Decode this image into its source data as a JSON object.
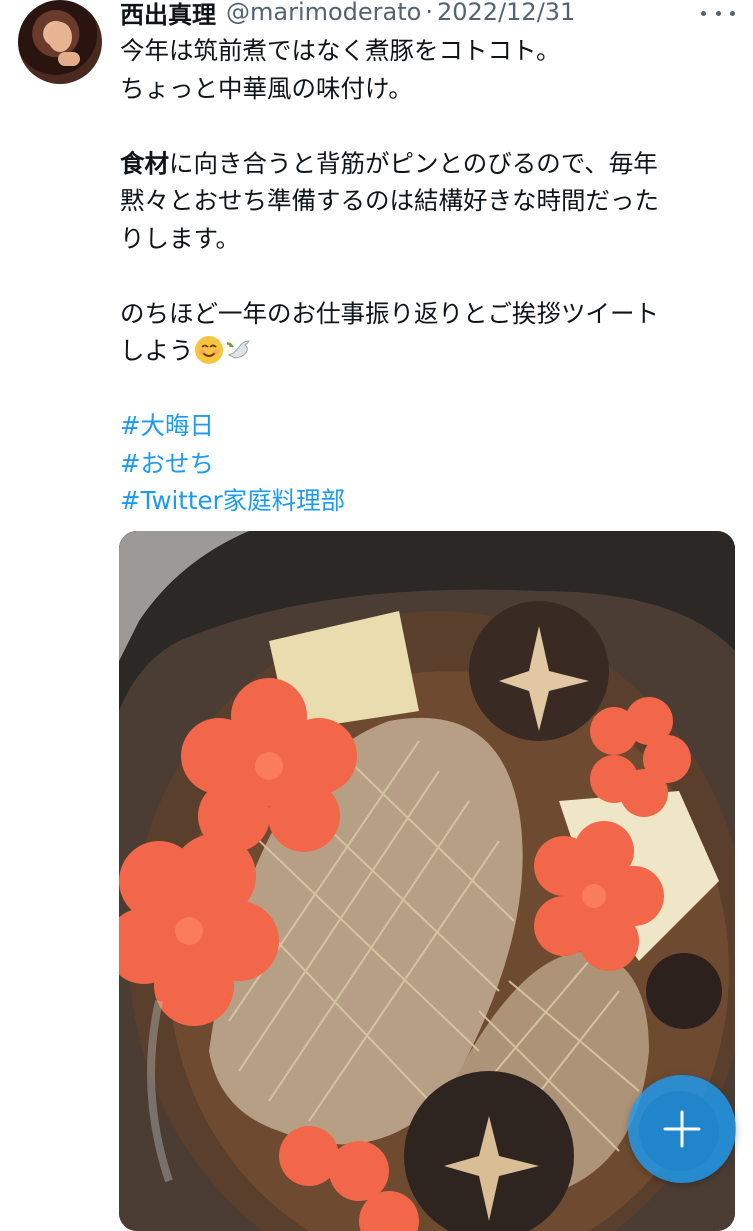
{
  "tweet": {
    "author": {
      "display_name": "西出真理",
      "handle": "@marimoderato",
      "separator": "·",
      "date": "2022/12/31"
    },
    "text_lines": {
      "l1": "今年は筑前煮ではなく煮豚をコトコト。",
      "l2": "ちょっと中華風の味付け。",
      "l3_bold": "食材",
      "l3_rest": "に向き合うと背筋がピンとのびるので、毎年",
      "l4": "黙々とおせち準備するのは結構好きな時間だった",
      "l5": "りします。",
      "l6": "のちほど一年のお仕事振り返りとご挨拶ツイート",
      "l7": "しよう"
    },
    "emojis": [
      "smiling-face-icon",
      "dove-icon"
    ],
    "hashtags": [
      "#大晦日",
      "#おせち",
      "#Twitter家庭料理部"
    ]
  },
  "colors": {
    "link": "#1d9bf0",
    "text": "#0f1419",
    "secondary": "#536471"
  },
  "icons": {
    "more": "more-horizontal-icon",
    "compose": "compose-plus-icon"
  }
}
